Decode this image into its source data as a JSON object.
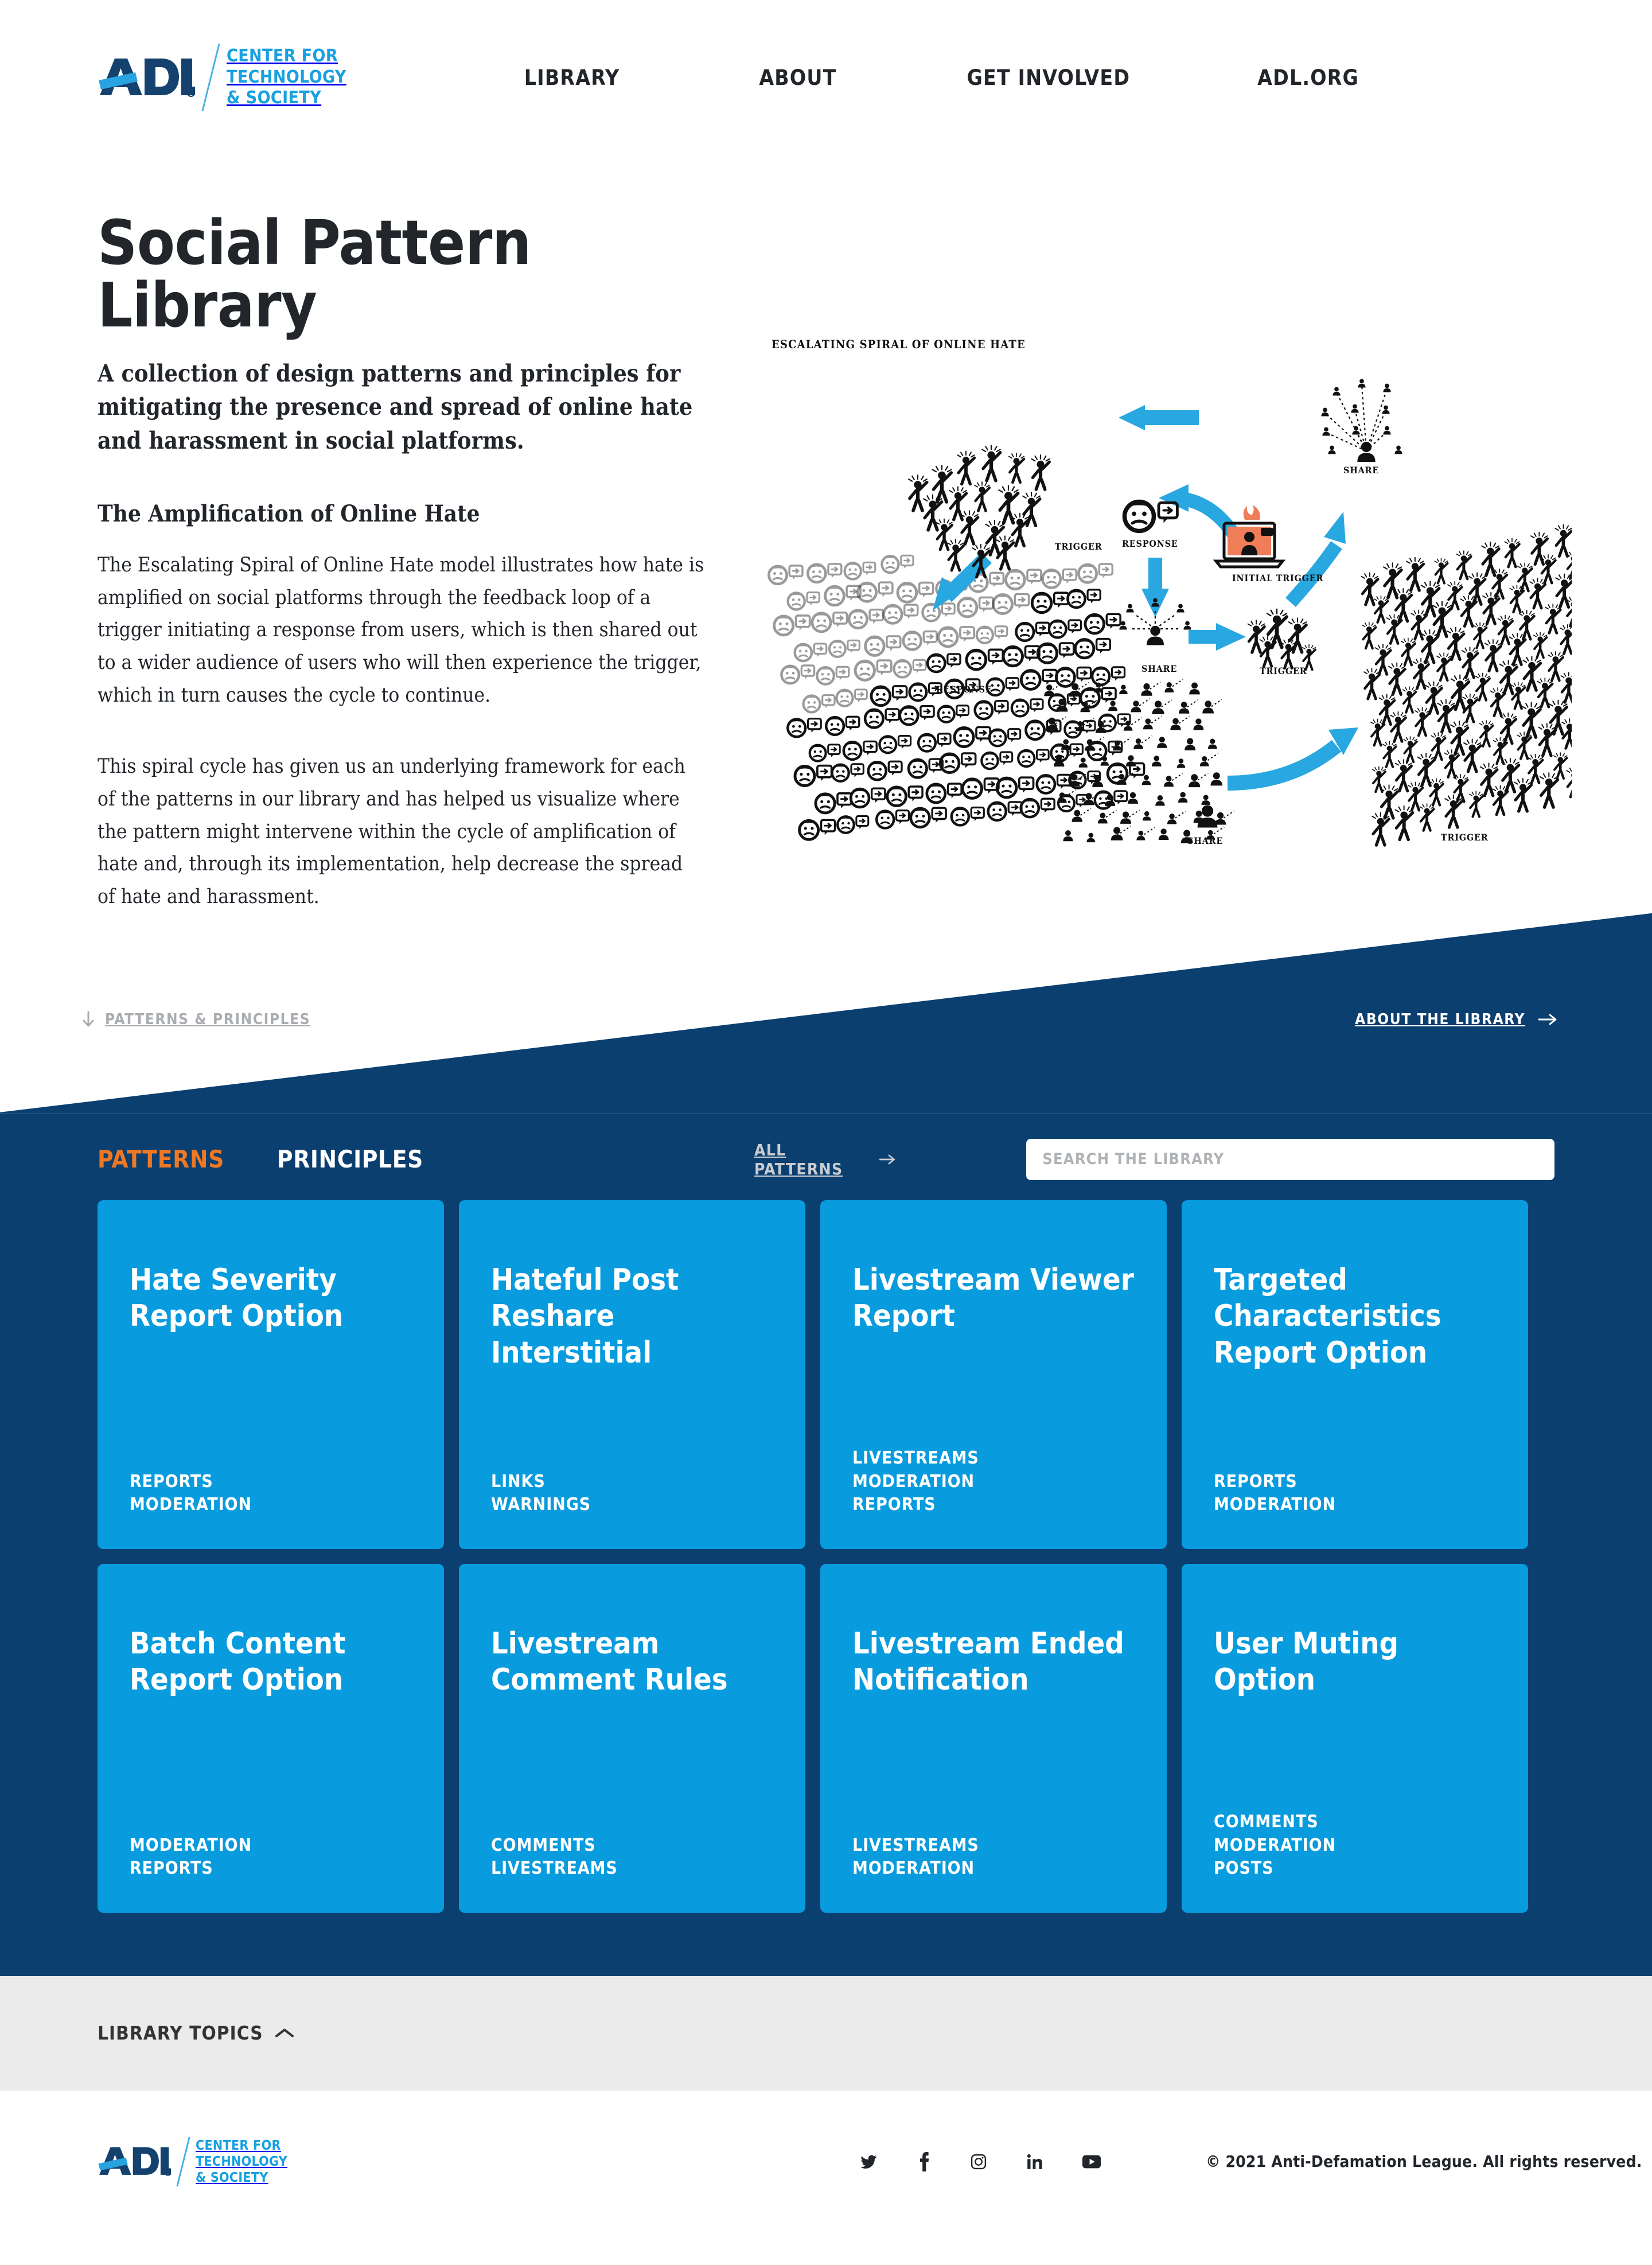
{
  "brand": {
    "logo_text": "ADL",
    "registered_mark": "®",
    "center_line1": "CENTER FOR",
    "center_line2": "TECHNOLOGY",
    "center_line3": "& SOCIETY",
    "navy": "#0b3f70",
    "light_blue": "#089bdd",
    "logo_blue": "#18a0e0",
    "accent_orange": "#f07822"
  },
  "nav": {
    "items": [
      {
        "label": "LIBRARY"
      },
      {
        "label": "ABOUT"
      },
      {
        "label": "GET INVOLVED"
      },
      {
        "label": "ADL.ORG"
      }
    ]
  },
  "hero": {
    "title": "Social Pattern Library",
    "subtitle": "A collection of design patterns and principles for mitigating the presence and spread of online hate and harassment in social platforms.",
    "section_heading": "The Amplification of Online Hate",
    "paragraph_1": "The Escalating Spiral of Online Hate model illustrates how hate is amplified on social platforms through the feedback loop of a trigger initiating a response from users, which is then shared out to a wider audience of users who will then experience the trigger, which in turn causes the cycle to continue.",
    "paragraph_2": "This spiral cycle has given us an underlying framework for each of the patterns in our library and has helped us visualize where the pattern might intervene within the cycle of amplification of hate and, through its implementation, help decrease the spread of hate and harassment."
  },
  "diagram": {
    "title": "ESCALATING SPIRAL OF ONLINE HATE",
    "labels": {
      "initial_trigger": "INITIAL TRIGGER",
      "response_1": "RESPONSE",
      "share_1": "SHARE",
      "trigger_1": "TRIGGER",
      "response_2": "RESPONSE",
      "share_2": "SHARE",
      "trigger_2": "TRIGGER",
      "share_3": "SHARE",
      "trigger_3": "TRIGGER"
    }
  },
  "band": {
    "patterns_principles": "PATTERNS & PRINCIPLES",
    "about_the_library": "ABOUT THE LIBRARY"
  },
  "library": {
    "tabs": [
      {
        "label": "PATTERNS",
        "active": true
      },
      {
        "label": "PRINCIPLES",
        "active": false
      }
    ],
    "all_patterns_label": "ALL PATTERNS",
    "search_placeholder": "SEARCH THE LIBRARY",
    "search_value": "",
    "cards": [
      {
        "title": "Hate Severity Report Option",
        "tags": [
          "REPORTS",
          "MODERATION"
        ]
      },
      {
        "title": "Hateful Post Reshare Interstitial",
        "tags": [
          "LINKS",
          "WARNINGS"
        ]
      },
      {
        "title": "Livestream Viewer Report",
        "tags": [
          "LIVESTREAMS",
          "MODERATION",
          "REPORTS"
        ]
      },
      {
        "title": "Targeted Characteristics Report Option",
        "tags": [
          "REPORTS",
          "MODERATION"
        ]
      },
      {
        "title": "Batch Content Report Option",
        "tags": [
          "MODERATION",
          "REPORTS"
        ]
      },
      {
        "title": "Livestream Comment Rules",
        "tags": [
          "COMMENTS",
          "LIVESTREAMS"
        ]
      },
      {
        "title": "Livestream Ended Notification",
        "tags": [
          "LIVESTREAMS",
          "MODERATION"
        ]
      },
      {
        "title": "User Muting Option",
        "tags": [
          "COMMENTS",
          "MODERATION",
          "POSTS"
        ]
      }
    ]
  },
  "topics": {
    "label": "LIBRARY TOPICS"
  },
  "footer": {
    "copyright": "© 2021 Anti-Defamation League. All rights reserved.",
    "socials": [
      {
        "name": "twitter-icon"
      },
      {
        "name": "facebook-icon"
      },
      {
        "name": "instagram-icon"
      },
      {
        "name": "linkedin-icon"
      },
      {
        "name": "youtube-icon"
      }
    ]
  }
}
